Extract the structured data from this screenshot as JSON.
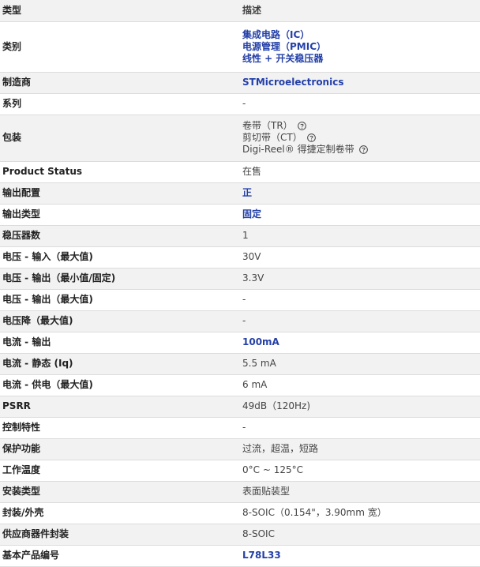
{
  "header": {
    "col_type": "类型",
    "col_desc": "描述"
  },
  "rows": [
    {
      "label": "类别",
      "values": [
        "集成电路（IC）",
        "电源管理（PMIC）",
        "线性 + 开关稳压器"
      ]
    },
    {
      "label": "制造商",
      "value": "STMicroelectronics"
    },
    {
      "label": "系列",
      "value": "-"
    },
    {
      "label": "包装",
      "values": [
        "卷带（TR）",
        "剪切带（CT）",
        "Digi-Reel® 得捷定制卷带"
      ]
    },
    {
      "label": "Product Status",
      "value": "在售"
    },
    {
      "label": "输出配置",
      "value": "正"
    },
    {
      "label": "输出类型",
      "value": "固定"
    },
    {
      "label": "稳压器数",
      "value": "1"
    },
    {
      "label": "电压 - 输入（最大值)",
      "value": "30V"
    },
    {
      "label": "电压 - 输出（最小值/固定)",
      "value": "3.3V"
    },
    {
      "label": "电压 - 输出（最大值)",
      "value": "-"
    },
    {
      "label": "电压降（最大值)",
      "value": "-"
    },
    {
      "label": "电流 - 输出",
      "value": "100mA"
    },
    {
      "label": "电流 - 静态 (Iq)",
      "value": "5.5 mA"
    },
    {
      "label": "电流 - 供电（最大值)",
      "value": "6 mA"
    },
    {
      "label": "PSRR",
      "value": "49dB（120Hz)"
    },
    {
      "label": "控制特性",
      "value": "-"
    },
    {
      "label": "保护功能",
      "value": "过流，超温，短路"
    },
    {
      "label": "工作温度",
      "value": "0°C ~ 125°C"
    },
    {
      "label": "安装类型",
      "value": "表面贴装型"
    },
    {
      "label": "封装/外壳",
      "value": "8-SOIC（0.154\"，3.90mm 宽）"
    },
    {
      "label": "供应商器件封装",
      "value": "8-SOIC"
    },
    {
      "label": "基本产品编号",
      "value": "L78L33"
    }
  ]
}
